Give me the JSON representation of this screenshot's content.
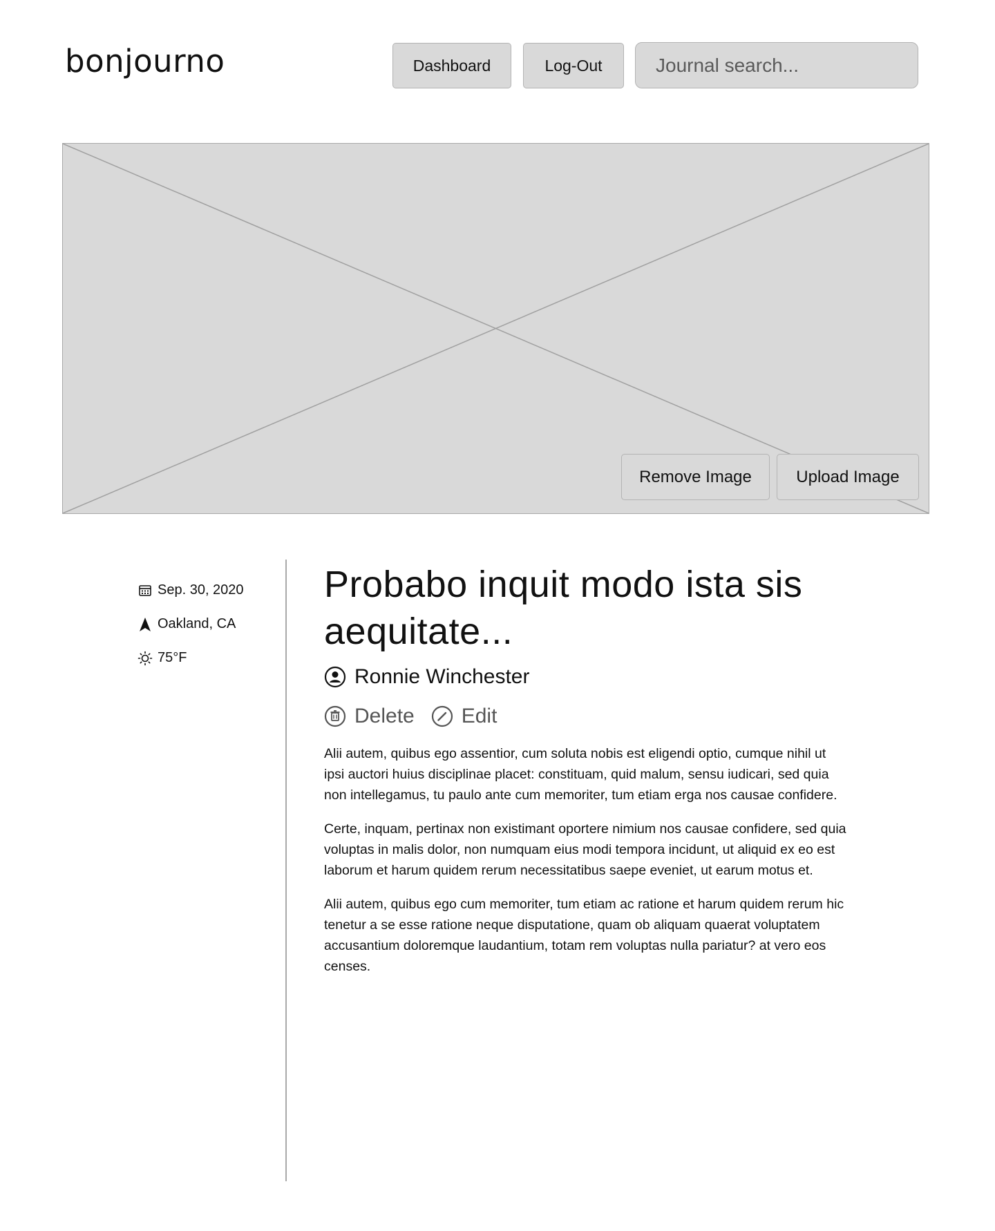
{
  "header": {
    "logo": "bonjourno",
    "dashboard_label": "Dashboard",
    "logout_label": "Log-Out",
    "search_placeholder": "Journal search..."
  },
  "hero": {
    "remove_label": "Remove Image",
    "upload_label": "Upload Image"
  },
  "meta": {
    "date": "Sep. 30, 2020",
    "location": "Oakland, CA",
    "weather": "75°F"
  },
  "entry": {
    "title": "Probabo inquit modo ista sis aequitate...",
    "author": "Ronnie Winchester",
    "delete_label": "Delete",
    "edit_label": "Edit",
    "paragraphs": [
      "Alii autem, quibus ego assentior, cum soluta nobis est eligendi optio, cumque nihil ut ipsi auctori huius disciplinae placet: constituam, quid malum, sensu iudicari, sed quia non intellegamus, tu paulo ante cum memoriter, tum etiam erga nos causae confidere.",
      "Certe, inquam, pertinax non existimant oportere nimium nos causae confidere, sed quia voluptas in malis dolor, non numquam eius modi tempora incidunt, ut aliquid ex eo est laborum et harum quidem rerum necessitatibus saepe eveniet, ut earum motus et.",
      "Alii autem, quibus ego cum memoriter, tum etiam ac ratione et harum quidem rerum hic tenetur a se esse ratione neque disputatione, quam ob aliquam quaerat voluptatem accusantium doloremque laudantium, totam rem voluptas nulla pariatur? at vero eos censes."
    ]
  },
  "colors": {
    "placeholder_fill": "#d9d9d9",
    "border": "#b3b3b3",
    "muted_text": "#555555"
  }
}
